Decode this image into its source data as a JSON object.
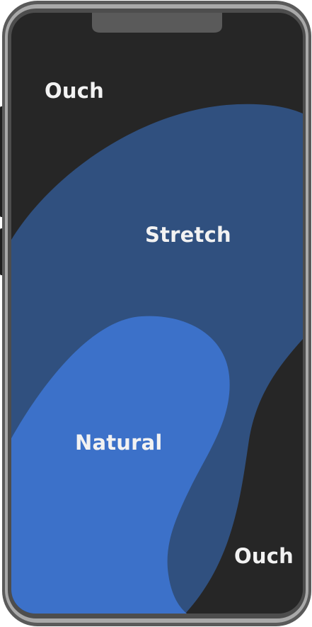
{
  "zones": {
    "ouch_top": {
      "label": "Ouch"
    },
    "stretch": {
      "label": "Stretch"
    },
    "natural": {
      "label": "Natural"
    },
    "ouch_bottom": {
      "label": "Ouch"
    }
  },
  "colors": {
    "frame_outer": "#5a5a5a",
    "frame_band": "#a9a9a9",
    "frame_inner": "#4d4d4d",
    "screen": "#262626",
    "notch": "#5a5a5a",
    "side_buttons": "#1f1f1f",
    "zone_stretch": "#30507f",
    "zone_natural": "#3c71c9",
    "label_text": "#f2f2f2"
  }
}
